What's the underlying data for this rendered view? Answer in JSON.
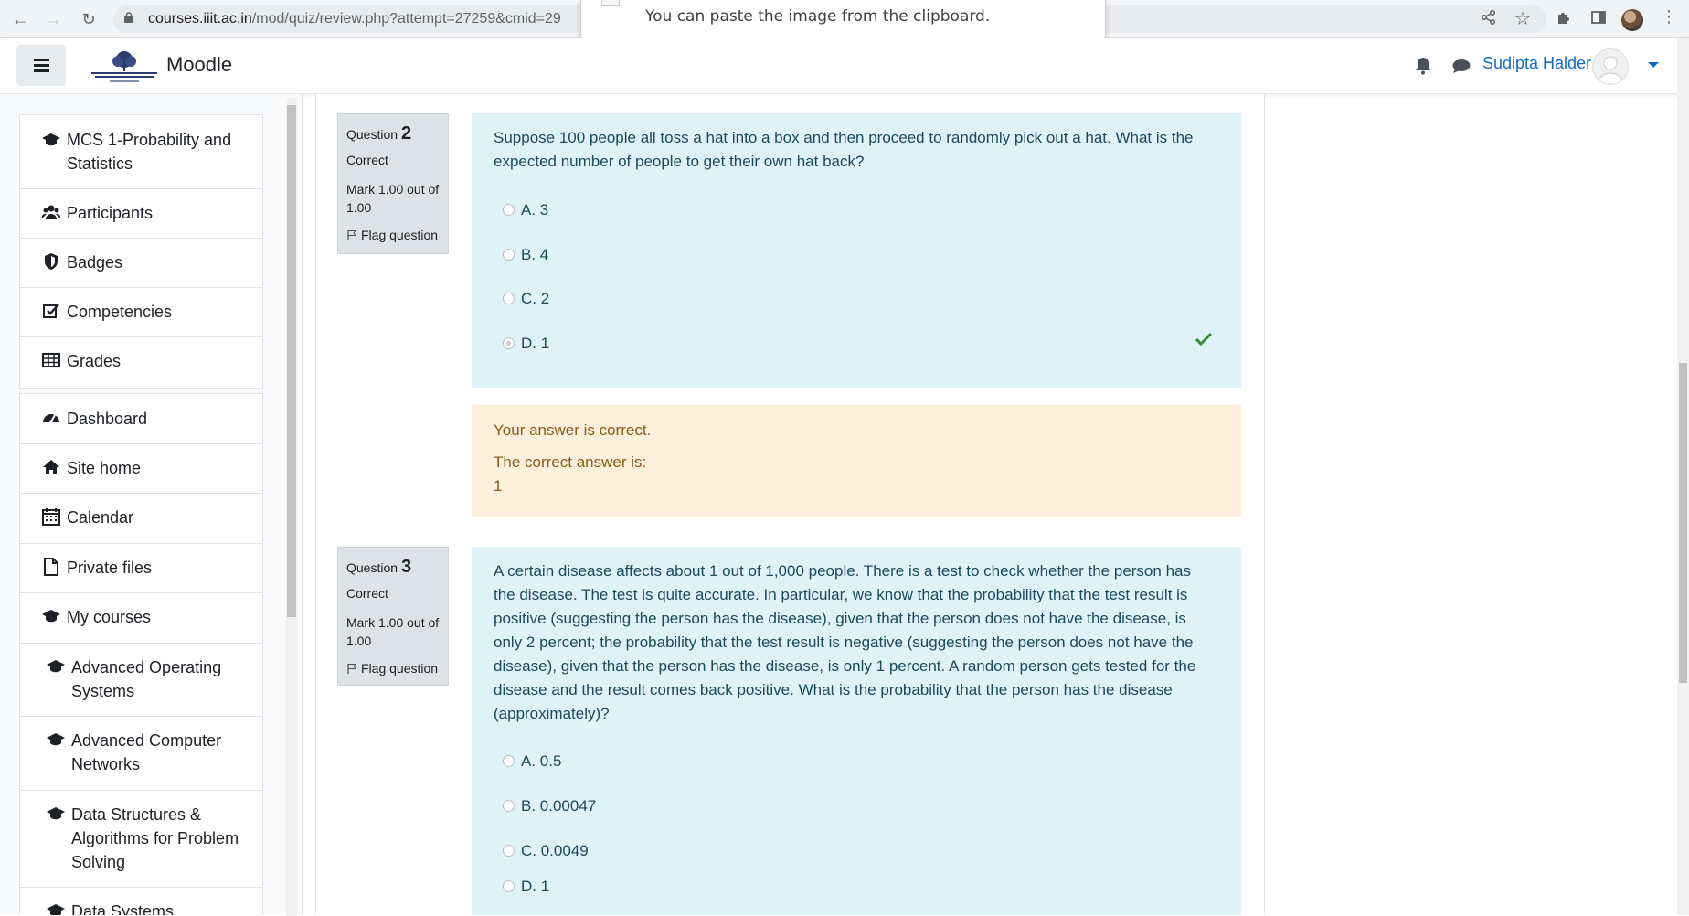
{
  "browser": {
    "url_host": "courses.iiit.ac.in",
    "url_path": "/mod/quiz/review.php?attempt=27259&cmid=29"
  },
  "toast": {
    "message": "You can paste the image from the clipboard."
  },
  "navbar": {
    "brand": "Moodle",
    "username": "Sudipta Halder"
  },
  "drawer": {
    "course_items": [
      {
        "label": "MCS 1-Probability and Statistics",
        "icon": "graduation-cap-icon"
      },
      {
        "label": "Participants",
        "icon": "users-icon"
      },
      {
        "label": "Badges",
        "icon": "shield-icon"
      },
      {
        "label": "Competencies",
        "icon": "check-square-icon"
      },
      {
        "label": "Grades",
        "icon": "table-icon"
      }
    ],
    "site_items": [
      {
        "label": "Dashboard",
        "icon": "dashboard-icon"
      },
      {
        "label": "Site home",
        "icon": "home-icon"
      },
      {
        "label": "Calendar",
        "icon": "calendar-icon"
      },
      {
        "label": "Private files",
        "icon": "file-icon"
      },
      {
        "label": "My courses",
        "icon": "graduation-cap-icon"
      },
      {
        "label": "Advanced Operating Systems",
        "icon": "graduation-cap-icon"
      },
      {
        "label": "Advanced Computer Networks",
        "icon": "graduation-cap-icon"
      },
      {
        "label": "Data Structures & Algorithms for Problem Solving",
        "icon": "graduation-cap-icon"
      },
      {
        "label": "Data Systems",
        "icon": "graduation-cap-icon"
      }
    ]
  },
  "questions": [
    {
      "label": "Question",
      "number": "2",
      "state": "Correct",
      "grade": "Mark 1.00 out of 1.00",
      "flag": "Flag question",
      "text": "Suppose 100 people all toss a hat into a box and then proceed to randomly pick out a hat. What is the expected number of people to get their own hat back?",
      "options": [
        "A. 3",
        "B. 4",
        "C. 2",
        "D. 1"
      ],
      "selected": "D. 1"
    },
    {
      "label": "Question",
      "number": "3",
      "state": "Correct",
      "grade": "Mark 1.00 out of 1.00",
      "flag": "Flag question",
      "text": "A certain disease affects about 1 out of 1,000 people. There is a test to check whether the person has the disease. The test is quite accurate. In particular, we know that the probability that the test result is positive (suggesting the person has the disease), given that the person does not have the disease, is only 2 percent; the probability that the test result is negative (suggesting the person does not have the disease), given that the person has the disease, is only 1 percent. A random person gets tested for the disease and the result comes back positive. What is the probability that the person has the disease (approximately)?",
      "options": [
        "A. 0.5",
        "B. 0.00047",
        "C. 0.0049",
        "D. 1"
      ]
    }
  ],
  "feedback": {
    "result": "Your answer is correct.",
    "correct_label": "The correct answer is:",
    "correct_value": "1"
  },
  "colors": {
    "link": "#0f6cbf",
    "formulation_bg": "#def2f8",
    "feedback_bg": "#fcefdc",
    "correct_tick": "#3a8a3a"
  }
}
